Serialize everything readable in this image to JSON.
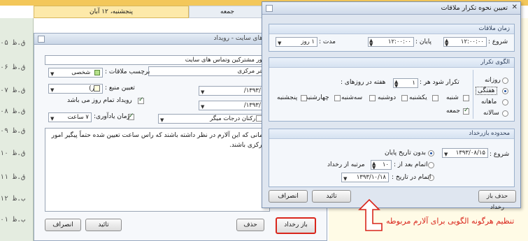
{
  "calendar": {
    "header_days": [
      "پنجشنبه، ۱۲ آبان",
      "جمعه"
    ],
    "time_rows": [
      "۰۵ ق.ظ",
      "۰۶ ق.ظ",
      "۰۷ ق.ظ",
      "۰۸ ق.ظ",
      "۰۹ ق.ظ",
      "۱۰ ق.ظ",
      "۱۱ ق.ظ",
      "۱۲ ب.ظ",
      "۰۱ ب.ظ"
    ]
  },
  "event_dialog": {
    "title": "امور مشترکین وتماس های سایت - رویداد",
    "subject": "امور مشترکین وتماس های سایت",
    "location": "دفتر مرکزی",
    "label_value": "شخصی",
    "label_caption": "برچسب ملاقات :",
    "source_value": "(هر)",
    "source_caption": "تعیین منبع :",
    "all_day_caption": "رویداد تمام روز می باشد",
    "reminder_caption": "زمان یادآوری:",
    "reminder_value": "۷ ساعت",
    "date1": "۱۳۹۳/۰۸/",
    "date2": "۱۳۹۳/۰۸/",
    "attendee": "کارکنان درجات میگر",
    "description": "زمانی که این آلارم در نظر داشته باشند که راس ساعت تعیین شده حتماً پیگیر امور مرکزی باشند.",
    "buttons": {
      "recurrence": "باز رخداد",
      "delete": "حذف",
      "ok": "تائید",
      "cancel": "انصراف"
    }
  },
  "recurrence_dialog": {
    "title": "تعیین نحوه تکرار ملاقات",
    "close_glyph": "✕",
    "time_section": {
      "title": "زمان ملاقات",
      "start_label": "شروع :",
      "start_value": "۱۲:۰۰:۰۰",
      "end_label": "پایان :",
      "end_value": "۱۲:۰۰:۰۰",
      "duration_label": "مدت :",
      "duration_value": "۱ روز"
    },
    "pattern_section": {
      "title": "الگوی تکرار",
      "options": [
        "روزانه",
        "هفتگی",
        "ماهانه",
        "سالانه"
      ],
      "selected": "هفتگی",
      "repeat_prefix": "تکرار شود هر :",
      "repeat_value": "۱",
      "repeat_suffix": "هفته در روزهای :",
      "days": [
        {
          "name": "شنبه",
          "checked": false
        },
        {
          "name": "یکشنبه",
          "checked": false
        },
        {
          "name": "دوشنبه",
          "checked": false
        },
        {
          "name": "سه‌شنبه",
          "checked": false
        },
        {
          "name": "چهارشنبه",
          "checked": false
        },
        {
          "name": "پنجشنبه",
          "checked": false
        },
        {
          "name": "جمعه",
          "checked": true
        }
      ]
    },
    "range_section": {
      "title": "محدوده بازرخداد",
      "start_label": "شروع :",
      "start_value": "۱۳۹۳/۰۸/۱۵",
      "no_end": "بدون تاریخ پایان",
      "end_after": "اتمام بعد از :",
      "end_after_value": "۱۰",
      "end_after_suffix": "مرتبه از رخداد",
      "end_by": "اتمام در تاریخ :",
      "end_by_value": "۱۳۹۳/۱۰/۱۸"
    },
    "buttons": {
      "cancel": "انصراف",
      "ok": "تائید",
      "remove": "حذف باز رخداد"
    }
  },
  "annotation": {
    "text": "تنظیم هرگونه الگویی برای آلارم مربوطه",
    "color": "#d9261c"
  }
}
